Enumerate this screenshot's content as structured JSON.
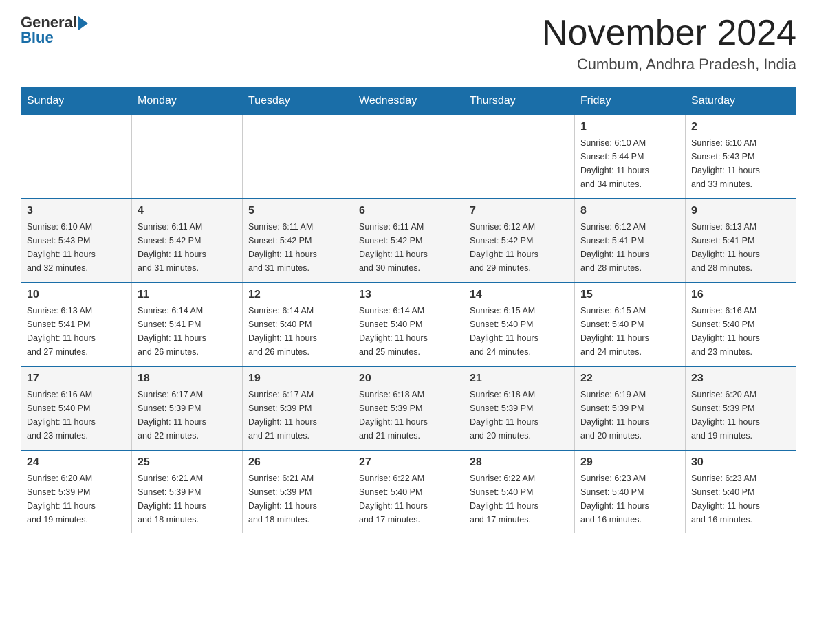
{
  "header": {
    "title": "November 2024",
    "location": "Cumbum, Andhra Pradesh, India",
    "logo_general": "General",
    "logo_blue": "Blue"
  },
  "weekdays": [
    "Sunday",
    "Monday",
    "Tuesday",
    "Wednesday",
    "Thursday",
    "Friday",
    "Saturday"
  ],
  "weeks": [
    [
      {
        "day": "",
        "info": ""
      },
      {
        "day": "",
        "info": ""
      },
      {
        "day": "",
        "info": ""
      },
      {
        "day": "",
        "info": ""
      },
      {
        "day": "",
        "info": ""
      },
      {
        "day": "1",
        "info": "Sunrise: 6:10 AM\nSunset: 5:44 PM\nDaylight: 11 hours\nand 34 minutes."
      },
      {
        "day": "2",
        "info": "Sunrise: 6:10 AM\nSunset: 5:43 PM\nDaylight: 11 hours\nand 33 minutes."
      }
    ],
    [
      {
        "day": "3",
        "info": "Sunrise: 6:10 AM\nSunset: 5:43 PM\nDaylight: 11 hours\nand 32 minutes."
      },
      {
        "day": "4",
        "info": "Sunrise: 6:11 AM\nSunset: 5:42 PM\nDaylight: 11 hours\nand 31 minutes."
      },
      {
        "day": "5",
        "info": "Sunrise: 6:11 AM\nSunset: 5:42 PM\nDaylight: 11 hours\nand 31 minutes."
      },
      {
        "day": "6",
        "info": "Sunrise: 6:11 AM\nSunset: 5:42 PM\nDaylight: 11 hours\nand 30 minutes."
      },
      {
        "day": "7",
        "info": "Sunrise: 6:12 AM\nSunset: 5:42 PM\nDaylight: 11 hours\nand 29 minutes."
      },
      {
        "day": "8",
        "info": "Sunrise: 6:12 AM\nSunset: 5:41 PM\nDaylight: 11 hours\nand 28 minutes."
      },
      {
        "day": "9",
        "info": "Sunrise: 6:13 AM\nSunset: 5:41 PM\nDaylight: 11 hours\nand 28 minutes."
      }
    ],
    [
      {
        "day": "10",
        "info": "Sunrise: 6:13 AM\nSunset: 5:41 PM\nDaylight: 11 hours\nand 27 minutes."
      },
      {
        "day": "11",
        "info": "Sunrise: 6:14 AM\nSunset: 5:41 PM\nDaylight: 11 hours\nand 26 minutes."
      },
      {
        "day": "12",
        "info": "Sunrise: 6:14 AM\nSunset: 5:40 PM\nDaylight: 11 hours\nand 26 minutes."
      },
      {
        "day": "13",
        "info": "Sunrise: 6:14 AM\nSunset: 5:40 PM\nDaylight: 11 hours\nand 25 minutes."
      },
      {
        "day": "14",
        "info": "Sunrise: 6:15 AM\nSunset: 5:40 PM\nDaylight: 11 hours\nand 24 minutes."
      },
      {
        "day": "15",
        "info": "Sunrise: 6:15 AM\nSunset: 5:40 PM\nDaylight: 11 hours\nand 24 minutes."
      },
      {
        "day": "16",
        "info": "Sunrise: 6:16 AM\nSunset: 5:40 PM\nDaylight: 11 hours\nand 23 minutes."
      }
    ],
    [
      {
        "day": "17",
        "info": "Sunrise: 6:16 AM\nSunset: 5:40 PM\nDaylight: 11 hours\nand 23 minutes."
      },
      {
        "day": "18",
        "info": "Sunrise: 6:17 AM\nSunset: 5:39 PM\nDaylight: 11 hours\nand 22 minutes."
      },
      {
        "day": "19",
        "info": "Sunrise: 6:17 AM\nSunset: 5:39 PM\nDaylight: 11 hours\nand 21 minutes."
      },
      {
        "day": "20",
        "info": "Sunrise: 6:18 AM\nSunset: 5:39 PM\nDaylight: 11 hours\nand 21 minutes."
      },
      {
        "day": "21",
        "info": "Sunrise: 6:18 AM\nSunset: 5:39 PM\nDaylight: 11 hours\nand 20 minutes."
      },
      {
        "day": "22",
        "info": "Sunrise: 6:19 AM\nSunset: 5:39 PM\nDaylight: 11 hours\nand 20 minutes."
      },
      {
        "day": "23",
        "info": "Sunrise: 6:20 AM\nSunset: 5:39 PM\nDaylight: 11 hours\nand 19 minutes."
      }
    ],
    [
      {
        "day": "24",
        "info": "Sunrise: 6:20 AM\nSunset: 5:39 PM\nDaylight: 11 hours\nand 19 minutes."
      },
      {
        "day": "25",
        "info": "Sunrise: 6:21 AM\nSunset: 5:39 PM\nDaylight: 11 hours\nand 18 minutes."
      },
      {
        "day": "26",
        "info": "Sunrise: 6:21 AM\nSunset: 5:39 PM\nDaylight: 11 hours\nand 18 minutes."
      },
      {
        "day": "27",
        "info": "Sunrise: 6:22 AM\nSunset: 5:40 PM\nDaylight: 11 hours\nand 17 minutes."
      },
      {
        "day": "28",
        "info": "Sunrise: 6:22 AM\nSunset: 5:40 PM\nDaylight: 11 hours\nand 17 minutes."
      },
      {
        "day": "29",
        "info": "Sunrise: 6:23 AM\nSunset: 5:40 PM\nDaylight: 11 hours\nand 16 minutes."
      },
      {
        "day": "30",
        "info": "Sunrise: 6:23 AM\nSunset: 5:40 PM\nDaylight: 11 hours\nand 16 minutes."
      }
    ]
  ]
}
